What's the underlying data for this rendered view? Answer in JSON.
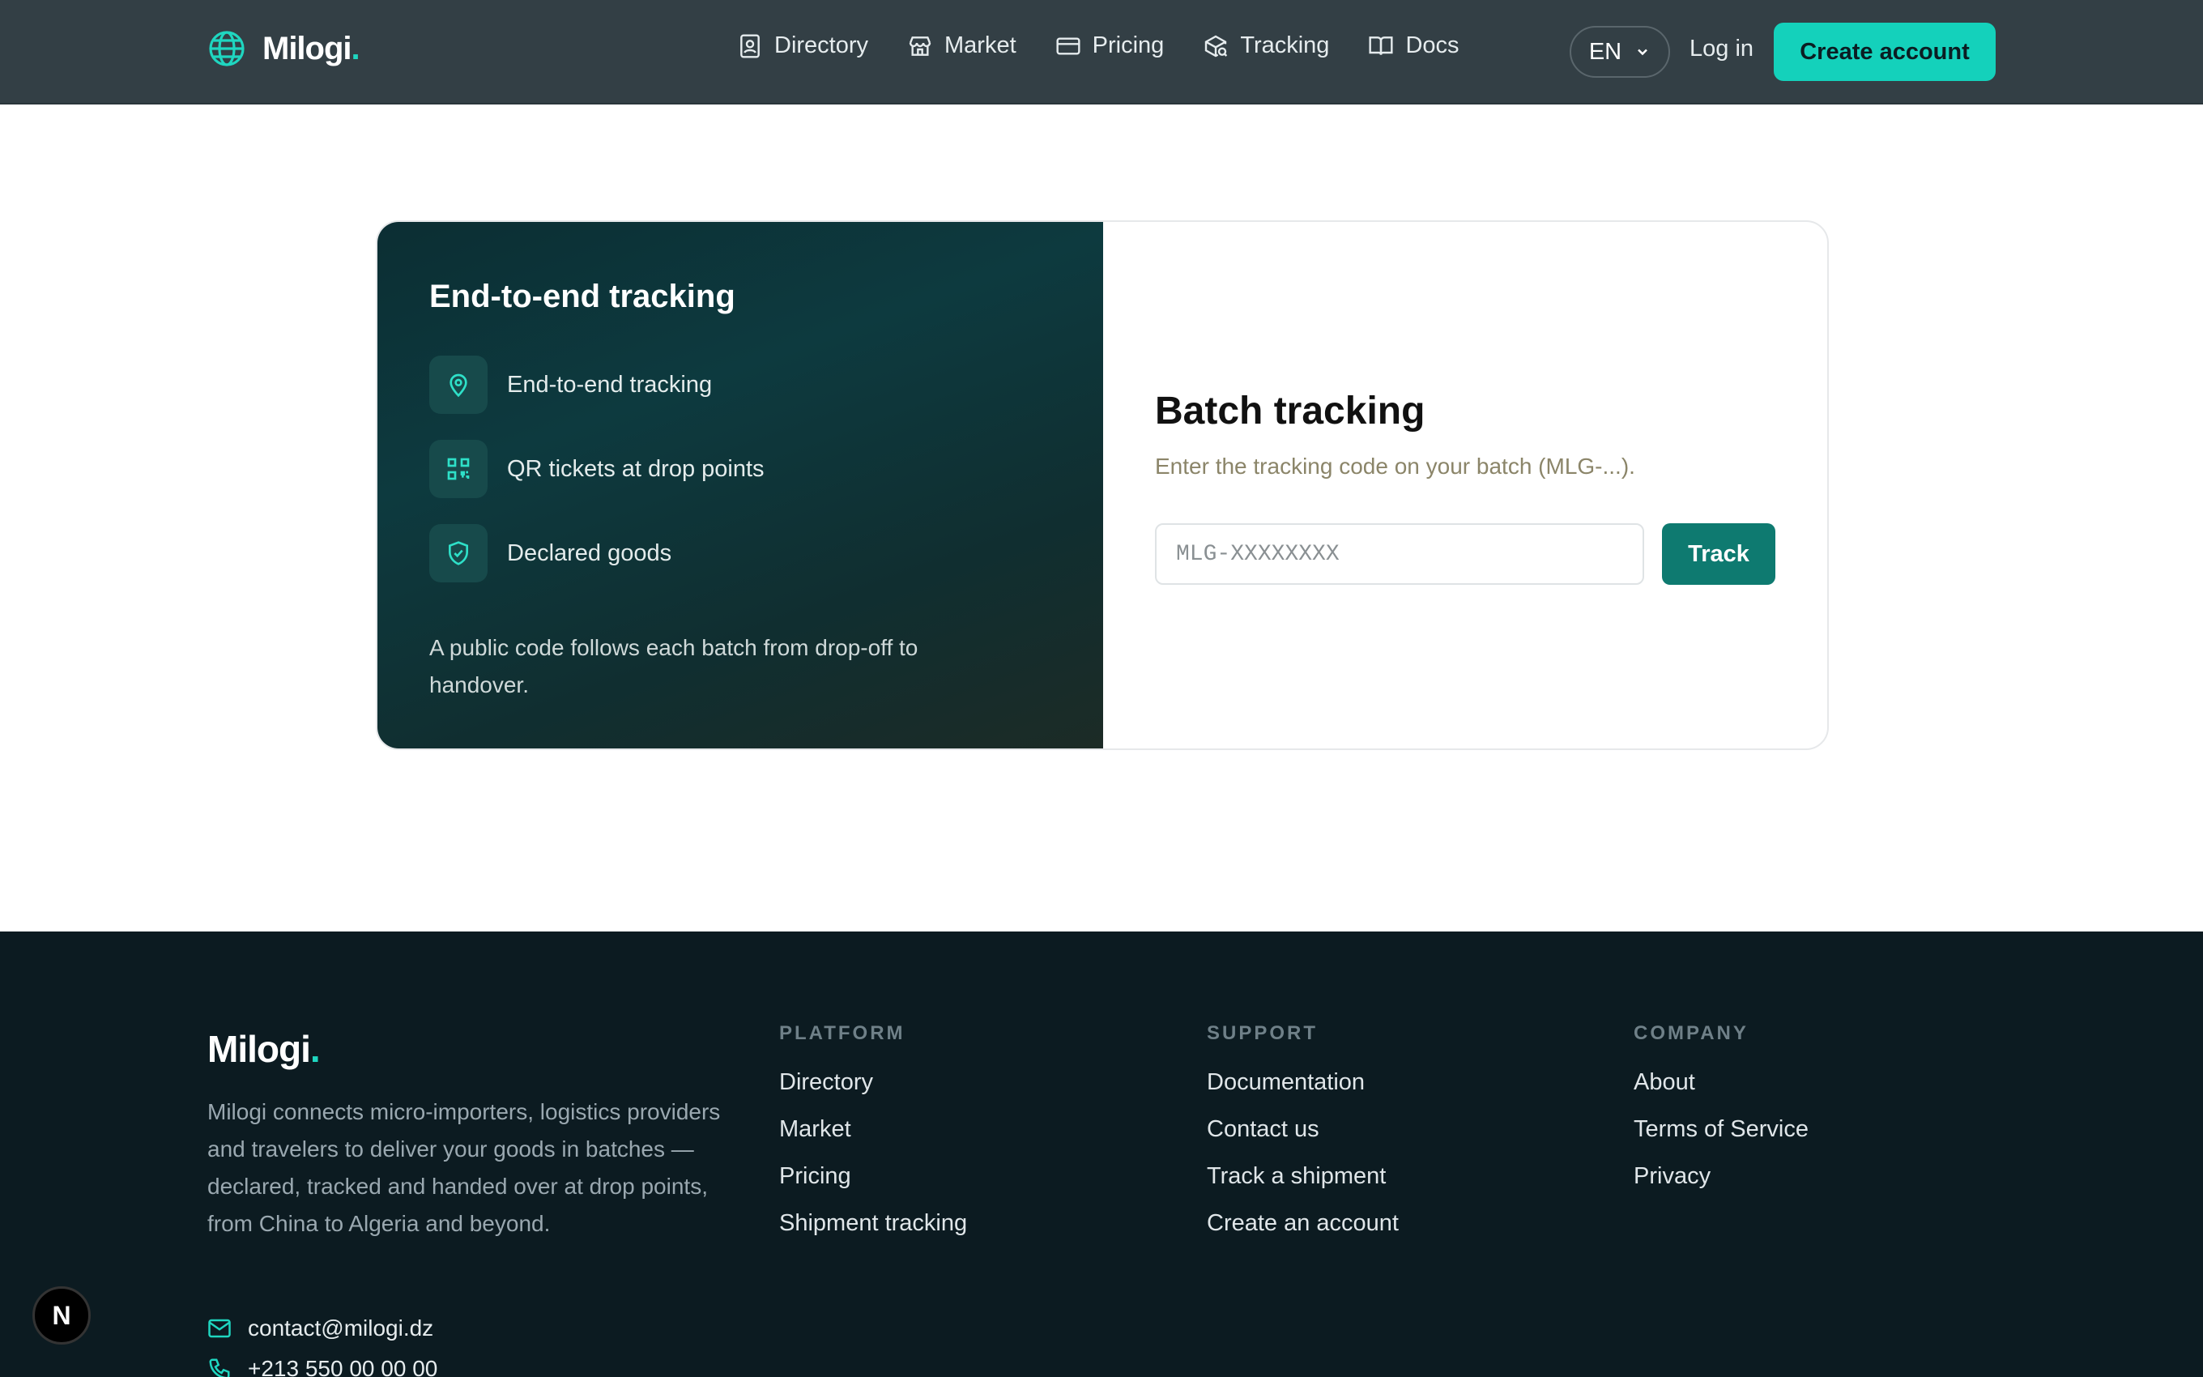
{
  "header": {
    "brand": "Milogi",
    "brand_dot": ".",
    "nav": [
      {
        "label": "Directory",
        "icon": "contact-book-icon"
      },
      {
        "label": "Market",
        "icon": "store-icon"
      },
      {
        "label": "Pricing",
        "icon": "credit-card-icon"
      },
      {
        "label": "Tracking",
        "icon": "package-search-icon"
      },
      {
        "label": "Docs",
        "icon": "book-open-icon"
      }
    ],
    "language": "EN",
    "login": "Log in",
    "create_account": "Create account"
  },
  "card": {
    "left_title": "End-to-end tracking",
    "features": [
      {
        "label": "End-to-end tracking",
        "icon": "map-pin-icon"
      },
      {
        "label": "QR tickets at drop points",
        "icon": "qr-code-icon"
      },
      {
        "label": "Declared goods",
        "icon": "shield-check-icon"
      }
    ],
    "left_description": "A public code follows each batch from drop-off to handover.",
    "title": "Batch tracking",
    "subtitle": "Enter the tracking code on your batch (MLG-...).",
    "input_placeholder": "MLG-XXXXXXXX",
    "input_value": "",
    "track_button": "Track"
  },
  "footer": {
    "brand": "Milogi",
    "brand_dot": ".",
    "description": "Milogi connects micro-importers, logistics providers and travelers to deliver your goods in batches — declared, tracked and handed over at drop points, from China to Algeria and beyond.",
    "email": "contact@milogi.dz",
    "phone": "+213 550 00 00 00",
    "columns": [
      {
        "title": "PLATFORM",
        "links": [
          "Directory",
          "Market",
          "Pricing",
          "Shipment tracking"
        ]
      },
      {
        "title": "SUPPORT",
        "links": [
          "Documentation",
          "Contact us",
          "Track a shipment",
          "Create an account"
        ]
      },
      {
        "title": "COMPANY",
        "links": [
          "About",
          "Terms of Service",
          "Privacy"
        ]
      }
    ]
  },
  "badge": "N",
  "colors": {
    "accent": "#14d1bb",
    "header_bg": "#333f45",
    "footer_bg": "#0c1b21",
    "track_button": "#0e7a70"
  }
}
